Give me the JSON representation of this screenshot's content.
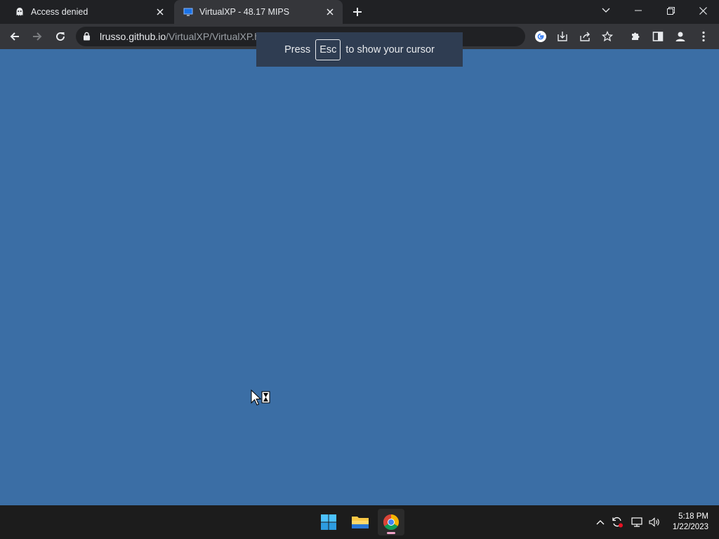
{
  "browser": {
    "tabs": [
      {
        "title": "Access denied",
        "icon": "incognito-ghost-icon",
        "active": false
      },
      {
        "title": "VirtualXP - 48.17 MIPS",
        "icon": "monitor-icon",
        "active": true
      }
    ],
    "address_bar": {
      "host": "lrusso.github.io",
      "path": "/VirtualXP/VirtualXP.htm"
    }
  },
  "fullscreen_hint": {
    "prefix": "Press",
    "key": "Esc",
    "suffix": "to show your cursor"
  },
  "taskbar": {
    "apps": [
      "windows-start-icon",
      "file-explorer-icon",
      "chrome-icon"
    ],
    "clock": {
      "time": "5:18 PM",
      "date": "1/22/2023"
    }
  },
  "colors": {
    "desktop_background": "#3b6ea5",
    "tab_strip": "#202124",
    "toolbar": "#35363a",
    "taskbar": "#1c1c1c"
  }
}
